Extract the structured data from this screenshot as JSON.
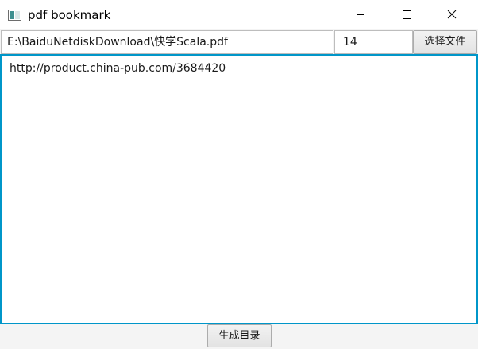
{
  "window": {
    "title": "pdf bookmark",
    "app_icon": "window-app-icon",
    "controls": {
      "minimize_icon": "minimize-icon",
      "maximize_icon": "maximize-icon",
      "close_icon": "close-icon"
    }
  },
  "toolbar": {
    "file_path": "E:\\BaiduNetdiskDownload\\快学Scala.pdf",
    "page_offset": "14",
    "choose_file_label": "选择文件"
  },
  "editor": {
    "content": "http://product.china-pub.com/3684420",
    "focus_color": "#0096c9"
  },
  "footer": {
    "generate_label": "生成目录"
  }
}
